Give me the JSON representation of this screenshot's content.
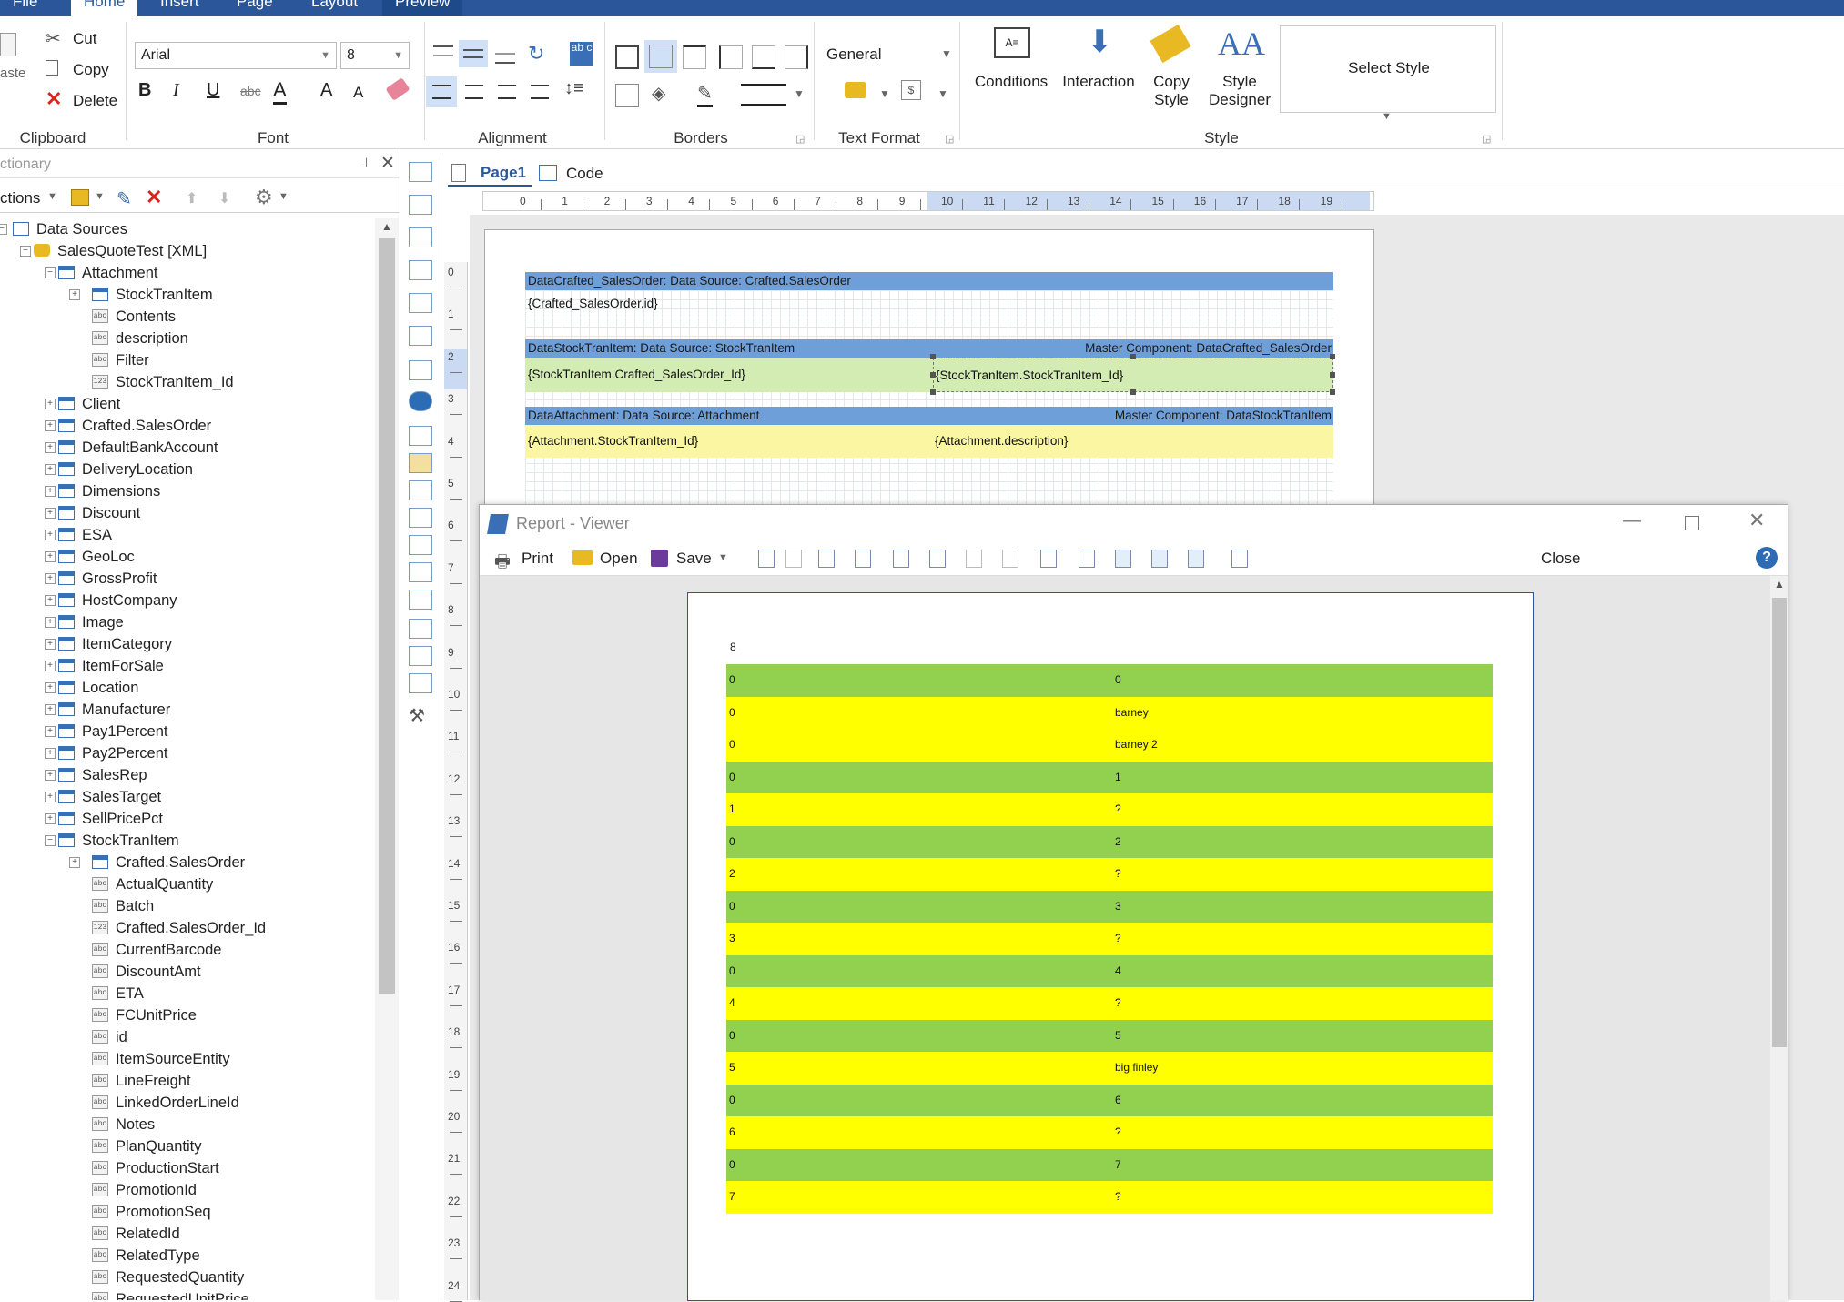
{
  "menu": {
    "file": "File",
    "home": "Home",
    "insert": "Insert",
    "page": "Page",
    "layout": "Layout",
    "preview": "Preview"
  },
  "clipboard": {
    "paste": "aste",
    "cut": "Cut",
    "copy": "Copy",
    "delete": "Delete",
    "label": "Clipboard"
  },
  "font": {
    "family": "Arial",
    "size": "8",
    "label": "Font"
  },
  "alignment": {
    "label": "Alignment"
  },
  "borders": {
    "label": "Borders"
  },
  "text_format": {
    "value": "General",
    "label": "Text Format"
  },
  "style": {
    "conditions": "Conditions",
    "interaction": "Interaction",
    "copy_style_1": "Copy",
    "copy_style_2": "Style",
    "style_designer_1": "Style",
    "style_designer_2": "Designer",
    "select_style": "Select Style",
    "label": "Style"
  },
  "dictionary": {
    "title": "ctionary",
    "actions": "ctions"
  },
  "tree": [
    {
      "t": "Data Sources",
      "lvl": 0,
      "kind": "root",
      "exp": "-"
    },
    {
      "t": "SalesQuoteTest [XML]",
      "lvl": 1,
      "kind": "db",
      "exp": "-"
    },
    {
      "t": "Attachment",
      "lvl": 2,
      "kind": "table",
      "exp": "-"
    },
    {
      "t": "StockTranItem",
      "lvl": 3,
      "kind": "rel",
      "exp": "+"
    },
    {
      "t": "Contents",
      "lvl": 3,
      "kind": "field",
      "tag": "abc"
    },
    {
      "t": "description",
      "lvl": 3,
      "kind": "field",
      "tag": "abc"
    },
    {
      "t": "Filter",
      "lvl": 3,
      "kind": "field",
      "tag": "abc"
    },
    {
      "t": "StockTranItem_Id",
      "lvl": 3,
      "kind": "field",
      "tag": "123"
    },
    {
      "t": "Client",
      "lvl": 2,
      "kind": "table",
      "exp": "+"
    },
    {
      "t": "Crafted.SalesOrder",
      "lvl": 2,
      "kind": "table",
      "exp": "+"
    },
    {
      "t": "DefaultBankAccount",
      "lvl": 2,
      "kind": "table",
      "exp": "+"
    },
    {
      "t": "DeliveryLocation",
      "lvl": 2,
      "kind": "table",
      "exp": "+"
    },
    {
      "t": "Dimensions",
      "lvl": 2,
      "kind": "table",
      "exp": "+"
    },
    {
      "t": "Discount",
      "lvl": 2,
      "kind": "table",
      "exp": "+"
    },
    {
      "t": "ESA",
      "lvl": 2,
      "kind": "table",
      "exp": "+"
    },
    {
      "t": "GeoLoc",
      "lvl": 2,
      "kind": "table",
      "exp": "+"
    },
    {
      "t": "GrossProfit",
      "lvl": 2,
      "kind": "table",
      "exp": "+"
    },
    {
      "t": "HostCompany",
      "lvl": 2,
      "kind": "table",
      "exp": "+"
    },
    {
      "t": "Image",
      "lvl": 2,
      "kind": "table",
      "exp": "+"
    },
    {
      "t": "ItemCategory",
      "lvl": 2,
      "kind": "table",
      "exp": "+"
    },
    {
      "t": "ItemForSale",
      "lvl": 2,
      "kind": "table",
      "exp": "+"
    },
    {
      "t": "Location",
      "lvl": 2,
      "kind": "table",
      "exp": "+"
    },
    {
      "t": "Manufacturer",
      "lvl": 2,
      "kind": "table",
      "exp": "+"
    },
    {
      "t": "Pay1Percent",
      "lvl": 2,
      "kind": "table",
      "exp": "+"
    },
    {
      "t": "Pay2Percent",
      "lvl": 2,
      "kind": "table",
      "exp": "+"
    },
    {
      "t": "SalesRep",
      "lvl": 2,
      "kind": "table",
      "exp": "+"
    },
    {
      "t": "SalesTarget",
      "lvl": 2,
      "kind": "table",
      "exp": "+"
    },
    {
      "t": "SellPricePct",
      "lvl": 2,
      "kind": "table",
      "exp": "+"
    },
    {
      "t": "StockTranItem",
      "lvl": 2,
      "kind": "table",
      "exp": "-"
    },
    {
      "t": "Crafted.SalesOrder",
      "lvl": 3,
      "kind": "rel",
      "exp": "+"
    },
    {
      "t": "ActualQuantity",
      "lvl": 3,
      "kind": "field",
      "tag": "abc"
    },
    {
      "t": "Batch",
      "lvl": 3,
      "kind": "field",
      "tag": "abc"
    },
    {
      "t": "Crafted.SalesOrder_Id",
      "lvl": 3,
      "kind": "field",
      "tag": "123"
    },
    {
      "t": "CurrentBarcode",
      "lvl": 3,
      "kind": "field",
      "tag": "abc"
    },
    {
      "t": "DiscountAmt",
      "lvl": 3,
      "kind": "field",
      "tag": "abc"
    },
    {
      "t": "ETA",
      "lvl": 3,
      "kind": "field",
      "tag": "abc"
    },
    {
      "t": "FCUnitPrice",
      "lvl": 3,
      "kind": "field",
      "tag": "abc"
    },
    {
      "t": "id",
      "lvl": 3,
      "kind": "field",
      "tag": "abc"
    },
    {
      "t": "ItemSourceEntity",
      "lvl": 3,
      "kind": "field",
      "tag": "abc"
    },
    {
      "t": "LineFreight",
      "lvl": 3,
      "kind": "field",
      "tag": "abc"
    },
    {
      "t": "LinkedOrderLineId",
      "lvl": 3,
      "kind": "field",
      "tag": "abc"
    },
    {
      "t": "Notes",
      "lvl": 3,
      "kind": "field",
      "tag": "abc"
    },
    {
      "t": "PlanQuantity",
      "lvl": 3,
      "kind": "field",
      "tag": "abc"
    },
    {
      "t": "ProductionStart",
      "lvl": 3,
      "kind": "field",
      "tag": "abc"
    },
    {
      "t": "PromotionId",
      "lvl": 3,
      "kind": "field",
      "tag": "abc"
    },
    {
      "t": "PromotionSeq",
      "lvl": 3,
      "kind": "field",
      "tag": "abc"
    },
    {
      "t": "RelatedId",
      "lvl": 3,
      "kind": "field",
      "tag": "abc"
    },
    {
      "t": "RelatedType",
      "lvl": 3,
      "kind": "field",
      "tag": "abc"
    },
    {
      "t": "RequestedQuantity",
      "lvl": 3,
      "kind": "field",
      "tag": "abc"
    },
    {
      "t": "RequestedUnitPrice",
      "lvl": 3,
      "kind": "field",
      "tag": "abc"
    }
  ],
  "tabs": {
    "page1": "Page1",
    "code": "Code"
  },
  "hruler": [
    "0",
    "1",
    "2",
    "3",
    "4",
    "5",
    "6",
    "7",
    "8",
    "9",
    "10",
    "11",
    "12",
    "13",
    "14",
    "15",
    "16",
    "17",
    "18",
    "19"
  ],
  "vruler": [
    "0",
    "1",
    "2",
    "3",
    "4",
    "5",
    "6",
    "7",
    "8",
    "9",
    "10",
    "11",
    "12",
    "13",
    "14",
    "15",
    "16",
    "17",
    "18",
    "19",
    "20",
    "21",
    "22",
    "23",
    "24"
  ],
  "bands": {
    "b1_header": "DataCrafted_SalesOrder: Data  Source: Crafted.SalesOrder",
    "b1_field": "{Crafted_SalesOrder.id}",
    "b2_header": "DataStockTranItem: Data Source: StockTranItem",
    "b2_master": "Master Component: DataCrafted_SalesOrder",
    "b2_field1": "{StockTranItem.Crafted_SalesOrder_Id}",
    "b2_field2": "{StockTranItem.StockTranItem_Id}",
    "b3_header": "DataAttachment: Data Source: Attachment",
    "b3_master": "Master Component: DataStockTranItem",
    "b3_field1": "{Attachment.StockTranItem_Id}",
    "b3_field2": "{Attachment.description}"
  },
  "viewer": {
    "title": "Report - Viewer",
    "print": "Print",
    "open": "Open",
    "save": "Save",
    "close": "Close",
    "help": "?"
  },
  "report": {
    "top": "8",
    "rows": [
      {
        "a": "0",
        "b": "0",
        "c": "green"
      },
      {
        "a": "0",
        "b": "barney",
        "c": "yellow"
      },
      {
        "a": "0",
        "b": "barney 2",
        "c": "yellow"
      },
      {
        "a": "0",
        "b": "1",
        "c": "green"
      },
      {
        "a": "1",
        "b": "?",
        "c": "yellow"
      },
      {
        "a": "0",
        "b": "2",
        "c": "green"
      },
      {
        "a": "2",
        "b": "?",
        "c": "yellow"
      },
      {
        "a": "0",
        "b": "3",
        "c": "green"
      },
      {
        "a": "3",
        "b": "?",
        "c": "yellow"
      },
      {
        "a": "0",
        "b": "4",
        "c": "green"
      },
      {
        "a": "4",
        "b": "?",
        "c": "yellow"
      },
      {
        "a": "0",
        "b": "5",
        "c": "green"
      },
      {
        "a": "5",
        "b": "big finley",
        "c": "yellow"
      },
      {
        "a": "0",
        "b": "6",
        "c": "green"
      },
      {
        "a": "6",
        "b": "?",
        "c": "yellow"
      },
      {
        "a": "0",
        "b": "7",
        "c": "green"
      },
      {
        "a": "7",
        "b": "?",
        "c": "yellow"
      }
    ]
  },
  "colors": {
    "accent": "#2b579a",
    "band_blue": "#6f9fd8",
    "band_green": "#d3ecb4",
    "band_yellow": "#fbf6a1",
    "row_green": "#92d050",
    "row_yellow": "#ffff00"
  }
}
